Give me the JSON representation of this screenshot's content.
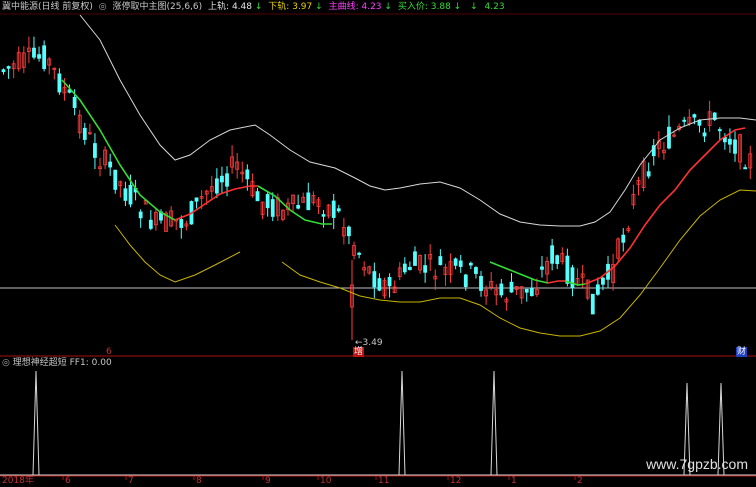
{
  "header": {
    "stock_title": "冀中能源(日线 前复权)",
    "indicator_title": "涨停取中主图(25,6,6)",
    "upper_label": "上轨:",
    "upper_value": "4.48",
    "lower_label": "下轨:",
    "lower_value": "3.97",
    "main_label": "主曲线:",
    "main_value": "4.23",
    "buy_label": "买入价:",
    "buy_value": "3.88",
    "extra_value": "4.23",
    "arrow": "↓"
  },
  "sub_header": {
    "indicator_title": "理想神经超短",
    "ff1_label": "FF1:",
    "ff1_value": "0.00"
  },
  "annotations": {
    "low_price": "3.49",
    "marker_zeng": "增",
    "marker_cai": "财",
    "marker_left": "6"
  },
  "time_axis": [
    "2018年",
    "6",
    "7",
    "8",
    "9",
    "10",
    "11",
    "12",
    "1",
    "2"
  ],
  "watermark": "www.7gpzb.com",
  "colors": {
    "up_candle": "#ff3c3c",
    "down_candle": "#54ffff",
    "main_curve": "#ff3030",
    "main_curve_green": "#33dd33",
    "upper_band": "#d8d8d8",
    "lower_band": "#c8b400",
    "support_line": "#c0c0c0",
    "axis_red": "#aa1010",
    "spike": "#d8d8d8"
  },
  "chart_data": [
    {
      "type": "candlestick",
      "title": "涨停取中主图(25,6,6)",
      "series": [
        {
          "name": "上轨",
          "last": 4.48
        },
        {
          "name": "下轨",
          "last": 3.97
        },
        {
          "name": "主曲线",
          "last": 4.23
        },
        {
          "name": "买入价",
          "last": 3.88
        }
      ],
      "annotations": [
        {
          "text": "3.49"
        }
      ]
    },
    {
      "type": "line",
      "title": "理想神经超短",
      "series": [
        {
          "name": "FF1",
          "last": 0.0
        }
      ],
      "x": [
        "2018年",
        "6",
        "7",
        "8",
        "9",
        "10",
        "11",
        "12",
        "1",
        "2"
      ]
    }
  ]
}
